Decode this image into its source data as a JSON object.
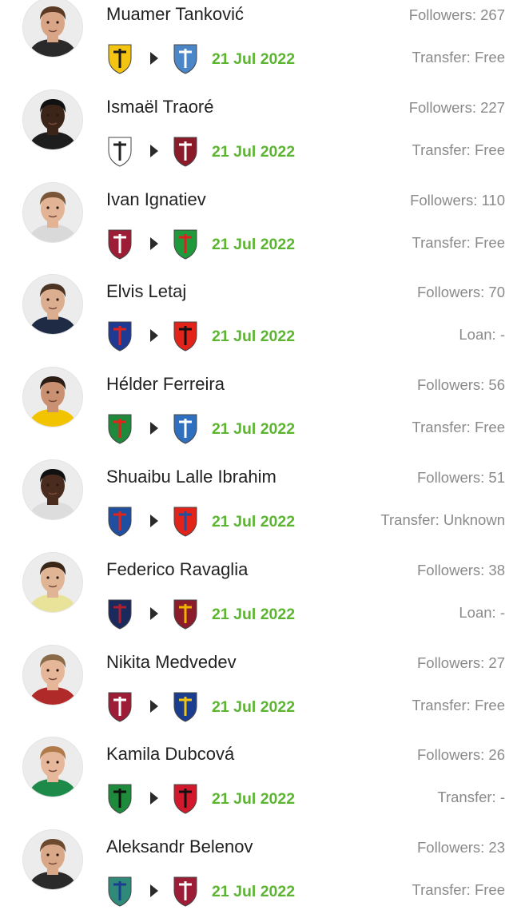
{
  "transfers": [
    {
      "player": "Muamer Tanković",
      "followers": "Followers: 267",
      "date": "21 Jul 2022",
      "fee": "Transfer: Free",
      "avatar": {
        "skin": "#d8a587",
        "hair": "#5a3a24",
        "shirt": "#2a2a2a"
      },
      "from_crest": {
        "icon": "aek-athens-crest-icon",
        "color": "#f3c411",
        "accent": "#1a1a1a"
      },
      "to_crest": {
        "icon": "pafos-crest-icon",
        "color": "#4a86c8",
        "accent": "#ffffff"
      }
    },
    {
      "player": "Ismaël Traoré",
      "followers": "Followers: 227",
      "date": "21 Jul 2022",
      "fee": "Transfer: Free",
      "avatar": {
        "skin": "#3b2418",
        "hair": "#111111",
        "shirt": "#1d1d1d"
      },
      "from_crest": {
        "icon": "angers-sco-crest-icon",
        "color": "#ffffff",
        "accent": "#222222"
      },
      "to_crest": {
        "icon": "fc-metz-crest-icon",
        "color": "#8c1b2a",
        "accent": "#ffffff"
      }
    },
    {
      "player": "Ivan Ignatiev",
      "followers": "Followers: 110",
      "date": "21 Jul 2022",
      "fee": "Transfer: Free",
      "avatar": {
        "skin": "#e2b394",
        "hair": "#7a5638",
        "shirt": "#d9d9d9"
      },
      "from_crest": {
        "icon": "rubin-kazan-crest-icon",
        "color": "#9c1d35",
        "accent": "#ffffff"
      },
      "to_crest": {
        "icon": "lokomotiv-moscow-crest-icon",
        "color": "#1e9a3c",
        "accent": "#e02020"
      }
    },
    {
      "player": "Elvis Letaj",
      "followers": "Followers: 70",
      "date": "21 Jul 2022",
      "fee": "Loan: -",
      "avatar": {
        "skin": "#dcae90",
        "hair": "#4b3424",
        "shirt": "#1f2a44"
      },
      "from_crest": {
        "icon": "hajduk-split-crest-icon",
        "color": "#1f3a93",
        "accent": "#e2231a"
      },
      "to_crest": {
        "icon": "kf-tirana-crest-icon",
        "color": "#e2231a",
        "accent": "#111111"
      }
    },
    {
      "player": "Hélder Ferreira",
      "followers": "Followers: 56",
      "date": "21 Jul 2022",
      "fee": "Transfer: Free",
      "avatar": {
        "skin": "#c99072",
        "hair": "#2b1c14",
        "shirt": "#f2c400"
      },
      "from_crest": {
        "icon": "pacos-ferreira-crest-icon",
        "color": "#1f8a3c",
        "accent": "#e2231a"
      },
      "to_crest": {
        "icon": "anorthosis-crest-icon",
        "color": "#2f6fc0",
        "accent": "#ffffff"
      }
    },
    {
      "player": "Shuaibu Lalle Ibrahim",
      "followers": "Followers: 51",
      "date": "21 Jul 2022",
      "fee": "Transfer: Unknown",
      "avatar": {
        "skin": "#4a2c1e",
        "hair": "#111111",
        "shirt": "#dddddd"
      },
      "from_crest": {
        "icon": "novi-pazar-crest-icon",
        "color": "#1f4fa0",
        "accent": "#e2231a"
      },
      "to_crest": {
        "icon": "proleter-crest-icon",
        "color": "#e2231a",
        "accent": "#1f4fa0"
      }
    },
    {
      "player": "Federico Ravaglia",
      "followers": "Followers: 38",
      "date": "21 Jul 2022",
      "fee": "Loan: -",
      "avatar": {
        "skin": "#e0b596",
        "hair": "#3a2619",
        "shirt": "#e9e39a"
      },
      "from_crest": {
        "icon": "bologna-crest-icon",
        "color": "#1a2a5c",
        "accent": "#b01f2e"
      },
      "to_crest": {
        "icon": "reggina-crest-icon",
        "color": "#8a1c2b",
        "accent": "#f0b400"
      }
    },
    {
      "player": "Nikita Medvedev",
      "followers": "Followers: 27",
      "date": "21 Jul 2022",
      "fee": "Transfer: Free",
      "avatar": {
        "skin": "#e5b698",
        "hair": "#8a6a48",
        "shirt": "#b02a2a"
      },
      "from_crest": {
        "icon": "rubin-kazan-crest-icon",
        "color": "#9c1d35",
        "accent": "#ffffff"
      },
      "to_crest": {
        "icon": "rostov-crest-icon",
        "color": "#1a3d8f",
        "accent": "#f3c411"
      }
    },
    {
      "player": "Kamila Dubcová",
      "followers": "Followers: 26",
      "date": "21 Jul 2022",
      "fee": "Transfer: -",
      "avatar": {
        "skin": "#e6b79a",
        "hair": "#b07a4a",
        "shirt": "#1d8a4a"
      },
      "from_crest": {
        "icon": "sassuolo-crest-icon",
        "color": "#1d8a3c",
        "accent": "#111111"
      },
      "to_crest": {
        "icon": "ac-milan-crest-icon",
        "color": "#d2192b",
        "accent": "#111111"
      }
    },
    {
      "player": "Aleksandr Belenov",
      "followers": "Followers: 23",
      "date": "21 Jul 2022",
      "fee": "Transfer: Free",
      "avatar": {
        "skin": "#d9a888",
        "hair": "#6b4a30",
        "shirt": "#2a2a2a"
      },
      "from_crest": {
        "icon": "ufa-crest-icon",
        "color": "#2f8a7a",
        "accent": "#1a3d8f"
      },
      "to_crest": {
        "icon": "rubin-kazan-crest-icon",
        "color": "#9c1d35",
        "accent": "#ffffff"
      }
    }
  ]
}
